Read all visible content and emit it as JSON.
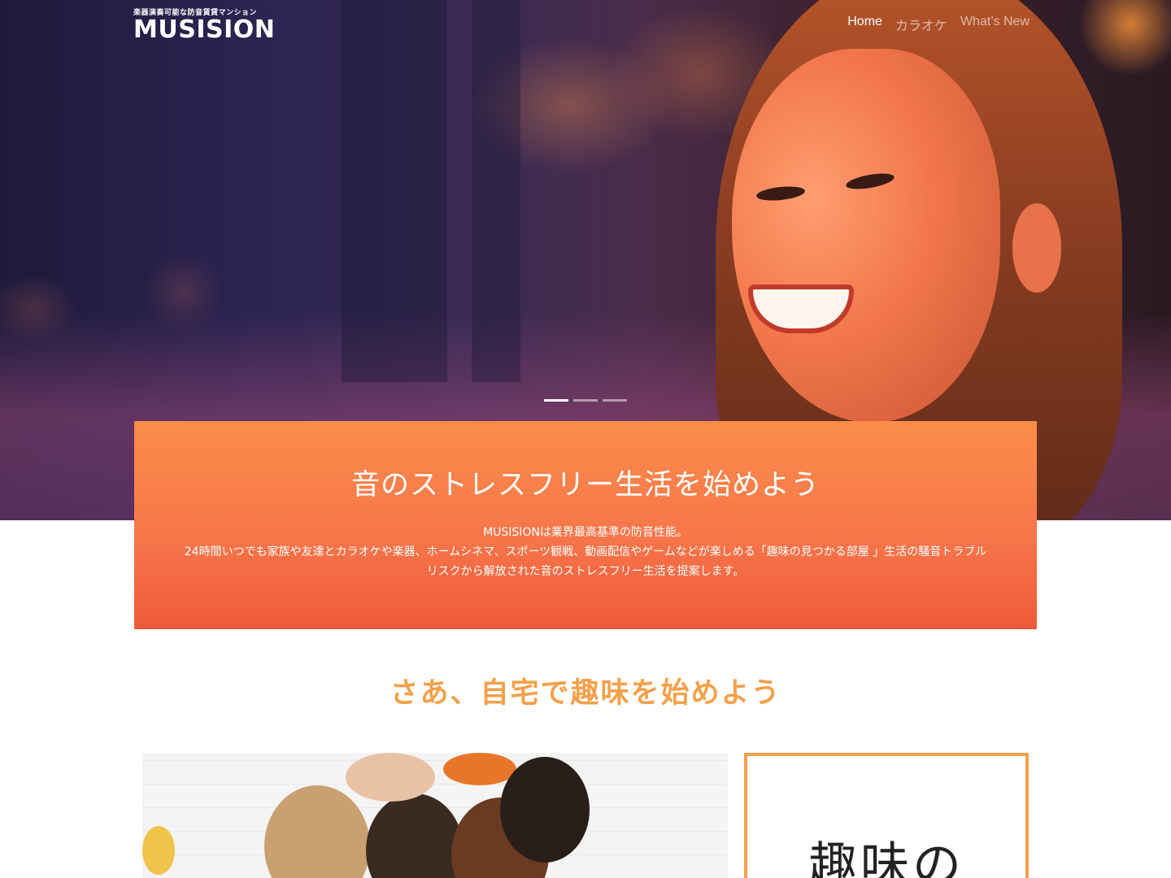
{
  "header": {
    "logo_tagline": "楽器演奏可能な防音賃貸マンション",
    "logo_name": "MUSISION",
    "nav": [
      {
        "label": "Home",
        "active": true
      },
      {
        "label": "カラオケ",
        "active": false
      },
      {
        "label": "What’s New",
        "active": false
      }
    ]
  },
  "carousel": {
    "slides": 3,
    "active_index": 0
  },
  "intro": {
    "title": "音のストレスフリー生活を始めよう",
    "line1": "MUSISIONは業界最高基準の防音性能。",
    "line2": "24時間いつでも家族や友達とカラオケや楽器、ホームシネマ、スポーツ観戦、動画配信やゲームなどが楽しめる「趣味の見つかる部屋 」生活の騒音トラブルリスクから解放された音のストレスフリー生活を提案します。"
  },
  "section": {
    "title": "さあ、自宅で趣味を始めよう"
  },
  "frame_box": {
    "text": "趣味の"
  },
  "colors": {
    "accent_orange": "#f5a04a",
    "intro_top": "#fb8d4a",
    "intro_bottom": "#ef5a3a"
  }
}
